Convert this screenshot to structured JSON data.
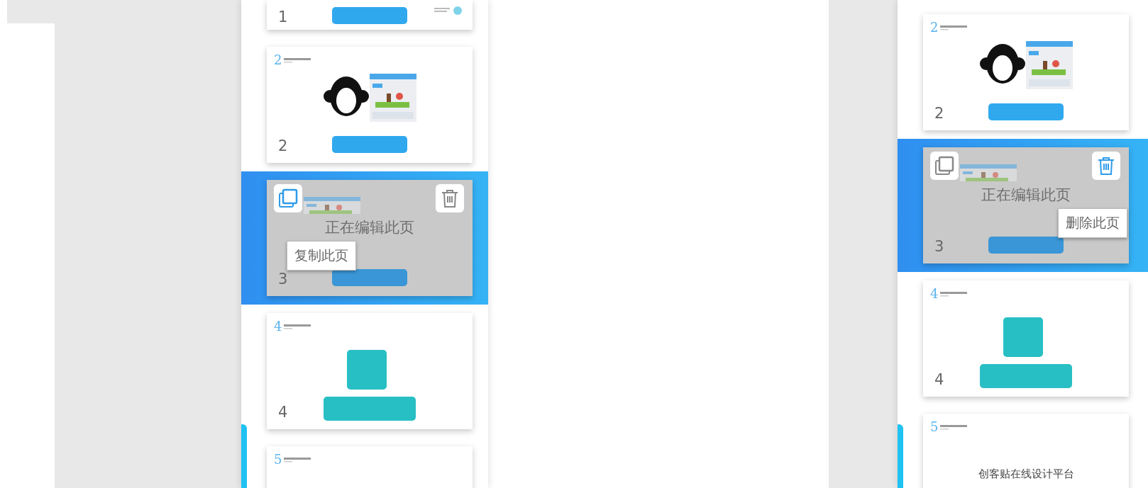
{
  "panels": [
    {
      "slides": [
        {
          "kind": "partial",
          "number": "1",
          "selected": false
        },
        {
          "kind": "monkey",
          "heading": "2",
          "number": "2",
          "selected": false
        },
        {
          "kind": "screenshot",
          "number": "3",
          "selected": true,
          "overlay": "正在编辑此页",
          "actions": [
            {
              "kind": "copy",
              "hovered": true,
              "tooltip": "复制此页"
            },
            {
              "kind": "delete",
              "hovered": false
            }
          ]
        },
        {
          "kind": "teal",
          "heading": "4",
          "number": "4",
          "selected": false
        },
        {
          "kind": "title",
          "heading": "5",
          "selected": false
        }
      ]
    },
    {
      "slides": [
        {
          "kind": "monkey",
          "heading": "2",
          "number": "2",
          "selected": false
        },
        {
          "kind": "screenshot",
          "number": "3",
          "selected": true,
          "overlay": "正在编辑此页",
          "actions": [
            {
              "kind": "copy",
              "hovered": false
            },
            {
              "kind": "delete",
              "hovered": true,
              "tooltip": "删除此页"
            }
          ]
        },
        {
          "kind": "teal",
          "heading": "4",
          "number": "4",
          "selected": false
        },
        {
          "kind": "title",
          "heading": "5",
          "title": "创客贴在线设计平台",
          "selected": false
        }
      ]
    }
  ]
}
